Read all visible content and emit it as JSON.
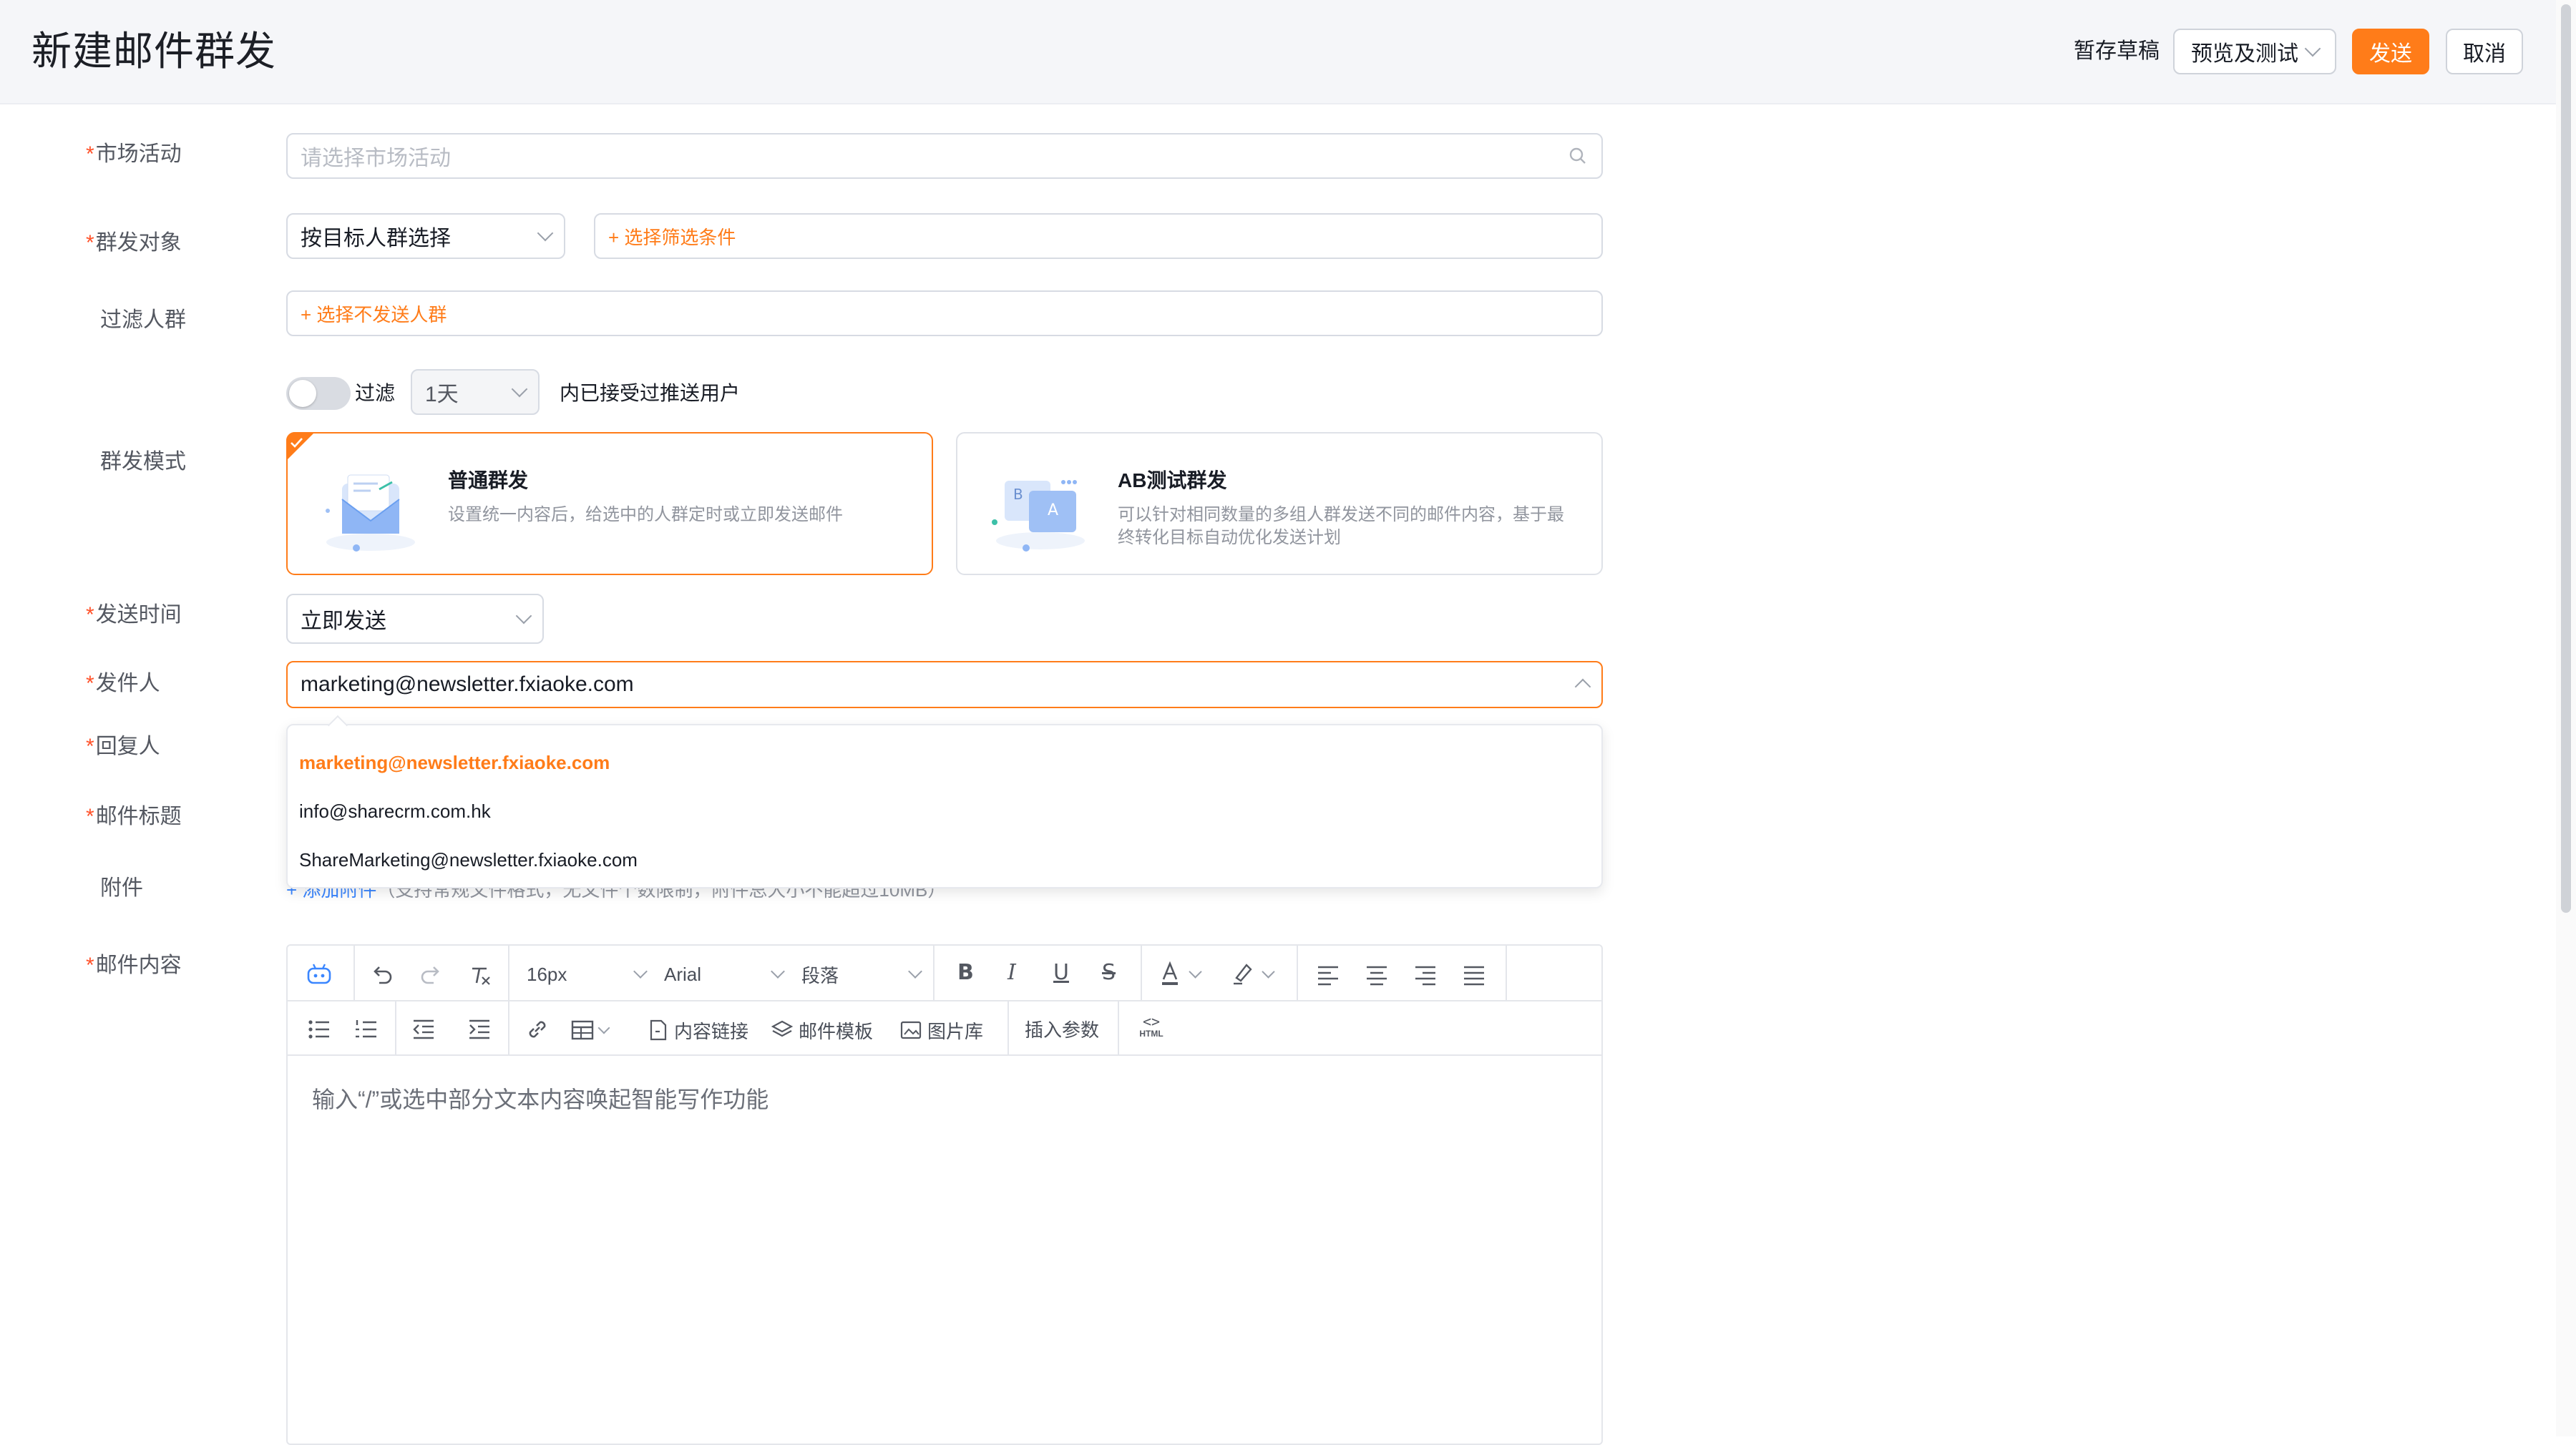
{
  "header": {
    "title": "新建邮件群发",
    "save_draft": "暂存草稿",
    "preview_test": "预览及测试",
    "send": "发送",
    "cancel": "取消"
  },
  "form": {
    "marketing": {
      "label": "市场活动",
      "placeholder": "请选择市场活动"
    },
    "audience": {
      "label": "群发对象",
      "select_value": "按目标人群选择",
      "add_filter": "+ 选择筛选条件"
    },
    "exclude": {
      "label": "过滤人群",
      "add": "+ 选择不发送人群"
    },
    "filter_rule": {
      "toggle_label": "过滤",
      "days_value": "1天",
      "suffix": "内已接受过推送用户"
    },
    "mode": {
      "label": "群发模式",
      "normal": {
        "title": "普通群发",
        "desc": "设置统一内容后，给选中的人群定时或立即发送邮件"
      },
      "ab": {
        "title": "AB测试群发",
        "desc_line1": "可以针对相同数量的多组人群发送不同的邮件内容，基于最",
        "desc_line2": "终转化目标自动优化发送计划"
      }
    },
    "send_time": {
      "label": "发送时间",
      "value": "立即发送"
    },
    "sender": {
      "label": "发件人",
      "value": "marketing@newsletter.fxiaoke.com",
      "options": [
        "marketing@newsletter.fxiaoke.com",
        "info@sharecrm.com.hk",
        "ShareMarketing@newsletter.fxiaoke.com"
      ]
    },
    "reply_to": {
      "label": "回复人"
    },
    "subject": {
      "label": "邮件标题"
    },
    "attachment": {
      "label": "附件",
      "add": "+ 添加附件",
      "hint": "（支持常规文件格式，无文件个数限制，附件总大小不能超过10MB）"
    },
    "content": {
      "label": "邮件内容",
      "placeholder": "输入“/”或选中部分文本内容唤起智能写作功能"
    }
  },
  "editor_toolbar": {
    "font_size": "16px",
    "font_family": "Arial",
    "block": "段落",
    "content_link": "内容链接",
    "mail_template": "邮件模板",
    "image_library": "图片库",
    "insert_param": "插入参数",
    "html": "HTML"
  },
  "colors": {
    "accent": "#ff7c19"
  }
}
